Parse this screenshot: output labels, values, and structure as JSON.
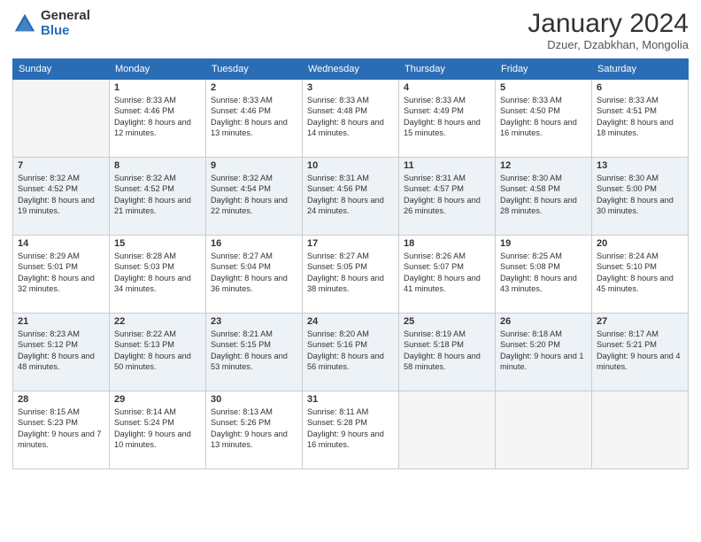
{
  "header": {
    "logo_general": "General",
    "logo_blue": "Blue",
    "month_title": "January 2024",
    "location": "Dzuer, Dzabkhan, Mongolia"
  },
  "days_of_week": [
    "Sunday",
    "Monday",
    "Tuesday",
    "Wednesday",
    "Thursday",
    "Friday",
    "Saturday"
  ],
  "weeks": [
    [
      {
        "day": "",
        "sunrise": "",
        "sunset": "",
        "daylight": ""
      },
      {
        "day": "1",
        "sunrise": "Sunrise: 8:33 AM",
        "sunset": "Sunset: 4:46 PM",
        "daylight": "Daylight: 8 hours and 12 minutes."
      },
      {
        "day": "2",
        "sunrise": "Sunrise: 8:33 AM",
        "sunset": "Sunset: 4:46 PM",
        "daylight": "Daylight: 8 hours and 13 minutes."
      },
      {
        "day": "3",
        "sunrise": "Sunrise: 8:33 AM",
        "sunset": "Sunset: 4:48 PM",
        "daylight": "Daylight: 8 hours and 14 minutes."
      },
      {
        "day": "4",
        "sunrise": "Sunrise: 8:33 AM",
        "sunset": "Sunset: 4:49 PM",
        "daylight": "Daylight: 8 hours and 15 minutes."
      },
      {
        "day": "5",
        "sunrise": "Sunrise: 8:33 AM",
        "sunset": "Sunset: 4:50 PM",
        "daylight": "Daylight: 8 hours and 16 minutes."
      },
      {
        "day": "6",
        "sunrise": "Sunrise: 8:33 AM",
        "sunset": "Sunset: 4:51 PM",
        "daylight": "Daylight: 8 hours and 18 minutes."
      }
    ],
    [
      {
        "day": "7",
        "sunrise": "Sunrise: 8:32 AM",
        "sunset": "Sunset: 4:52 PM",
        "daylight": "Daylight: 8 hours and 19 minutes."
      },
      {
        "day": "8",
        "sunrise": "Sunrise: 8:32 AM",
        "sunset": "Sunset: 4:52 PM",
        "daylight": "Daylight: 8 hours and 21 minutes."
      },
      {
        "day": "9",
        "sunrise": "Sunrise: 8:32 AM",
        "sunset": "Sunset: 4:54 PM",
        "daylight": "Daylight: 8 hours and 22 minutes."
      },
      {
        "day": "10",
        "sunrise": "Sunrise: 8:31 AM",
        "sunset": "Sunset: 4:56 PM",
        "daylight": "Daylight: 8 hours and 24 minutes."
      },
      {
        "day": "11",
        "sunrise": "Sunrise: 8:31 AM",
        "sunset": "Sunset: 4:57 PM",
        "daylight": "Daylight: 8 hours and 26 minutes."
      },
      {
        "day": "12",
        "sunrise": "Sunrise: 8:30 AM",
        "sunset": "Sunset: 4:58 PM",
        "daylight": "Daylight: 8 hours and 28 minutes."
      },
      {
        "day": "13",
        "sunrise": "Sunrise: 8:30 AM",
        "sunset": "Sunset: 5:00 PM",
        "daylight": "Daylight: 8 hours and 30 minutes."
      }
    ],
    [
      {
        "day": "14",
        "sunrise": "Sunrise: 8:29 AM",
        "sunset": "Sunset: 5:01 PM",
        "daylight": "Daylight: 8 hours and 32 minutes."
      },
      {
        "day": "15",
        "sunrise": "Sunrise: 8:28 AM",
        "sunset": "Sunset: 5:03 PM",
        "daylight": "Daylight: 8 hours and 34 minutes."
      },
      {
        "day": "16",
        "sunrise": "Sunrise: 8:27 AM",
        "sunset": "Sunset: 5:04 PM",
        "daylight": "Daylight: 8 hours and 36 minutes."
      },
      {
        "day": "17",
        "sunrise": "Sunrise: 8:27 AM",
        "sunset": "Sunset: 5:05 PM",
        "daylight": "Daylight: 8 hours and 38 minutes."
      },
      {
        "day": "18",
        "sunrise": "Sunrise: 8:26 AM",
        "sunset": "Sunset: 5:07 PM",
        "daylight": "Daylight: 8 hours and 41 minutes."
      },
      {
        "day": "19",
        "sunrise": "Sunrise: 8:25 AM",
        "sunset": "Sunset: 5:08 PM",
        "daylight": "Daylight: 8 hours and 43 minutes."
      },
      {
        "day": "20",
        "sunrise": "Sunrise: 8:24 AM",
        "sunset": "Sunset: 5:10 PM",
        "daylight": "Daylight: 8 hours and 45 minutes."
      }
    ],
    [
      {
        "day": "21",
        "sunrise": "Sunrise: 8:23 AM",
        "sunset": "Sunset: 5:12 PM",
        "daylight": "Daylight: 8 hours and 48 minutes."
      },
      {
        "day": "22",
        "sunrise": "Sunrise: 8:22 AM",
        "sunset": "Sunset: 5:13 PM",
        "daylight": "Daylight: 8 hours and 50 minutes."
      },
      {
        "day": "23",
        "sunrise": "Sunrise: 8:21 AM",
        "sunset": "Sunset: 5:15 PM",
        "daylight": "Daylight: 8 hours and 53 minutes."
      },
      {
        "day": "24",
        "sunrise": "Sunrise: 8:20 AM",
        "sunset": "Sunset: 5:16 PM",
        "daylight": "Daylight: 8 hours and 56 minutes."
      },
      {
        "day": "25",
        "sunrise": "Sunrise: 8:19 AM",
        "sunset": "Sunset: 5:18 PM",
        "daylight": "Daylight: 8 hours and 58 minutes."
      },
      {
        "day": "26",
        "sunrise": "Sunrise: 8:18 AM",
        "sunset": "Sunset: 5:20 PM",
        "daylight": "Daylight: 9 hours and 1 minute."
      },
      {
        "day": "27",
        "sunrise": "Sunrise: 8:17 AM",
        "sunset": "Sunset: 5:21 PM",
        "daylight": "Daylight: 9 hours and 4 minutes."
      }
    ],
    [
      {
        "day": "28",
        "sunrise": "Sunrise: 8:15 AM",
        "sunset": "Sunset: 5:23 PM",
        "daylight": "Daylight: 9 hours and 7 minutes."
      },
      {
        "day": "29",
        "sunrise": "Sunrise: 8:14 AM",
        "sunset": "Sunset: 5:24 PM",
        "daylight": "Daylight: 9 hours and 10 minutes."
      },
      {
        "day": "30",
        "sunrise": "Sunrise: 8:13 AM",
        "sunset": "Sunset: 5:26 PM",
        "daylight": "Daylight: 9 hours and 13 minutes."
      },
      {
        "day": "31",
        "sunrise": "Sunrise: 8:11 AM",
        "sunset": "Sunset: 5:28 PM",
        "daylight": "Daylight: 9 hours and 16 minutes."
      },
      {
        "day": "",
        "sunrise": "",
        "sunset": "",
        "daylight": ""
      },
      {
        "day": "",
        "sunrise": "",
        "sunset": "",
        "daylight": ""
      },
      {
        "day": "",
        "sunrise": "",
        "sunset": "",
        "daylight": ""
      }
    ]
  ]
}
